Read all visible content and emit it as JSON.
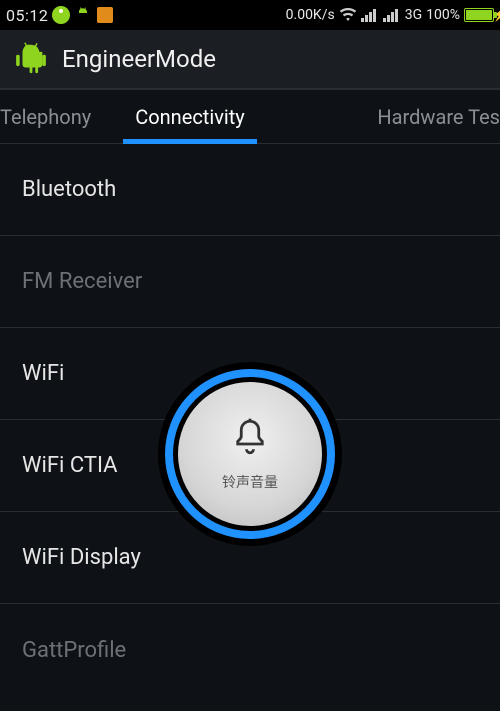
{
  "status": {
    "time": "05:12",
    "data_rate": "0.00K/s",
    "network_label": "3G",
    "battery_pct": "100%"
  },
  "app": {
    "title": "EngineerMode"
  },
  "tabs": [
    {
      "label": "Telephony",
      "active": false
    },
    {
      "label": "Connectivity",
      "active": true
    },
    {
      "label": "Hardware Tes",
      "active": false
    }
  ],
  "list": [
    {
      "label": "Bluetooth",
      "dim": false
    },
    {
      "label": "FM Receiver",
      "dim": true
    },
    {
      "label": "WiFi",
      "dim": false
    },
    {
      "label": "WiFi CTIA",
      "dim": false
    },
    {
      "label": "WiFi Display",
      "dim": false
    },
    {
      "label": "GattProfile",
      "dim": true
    }
  ],
  "overlay": {
    "label": "铃声音量"
  }
}
